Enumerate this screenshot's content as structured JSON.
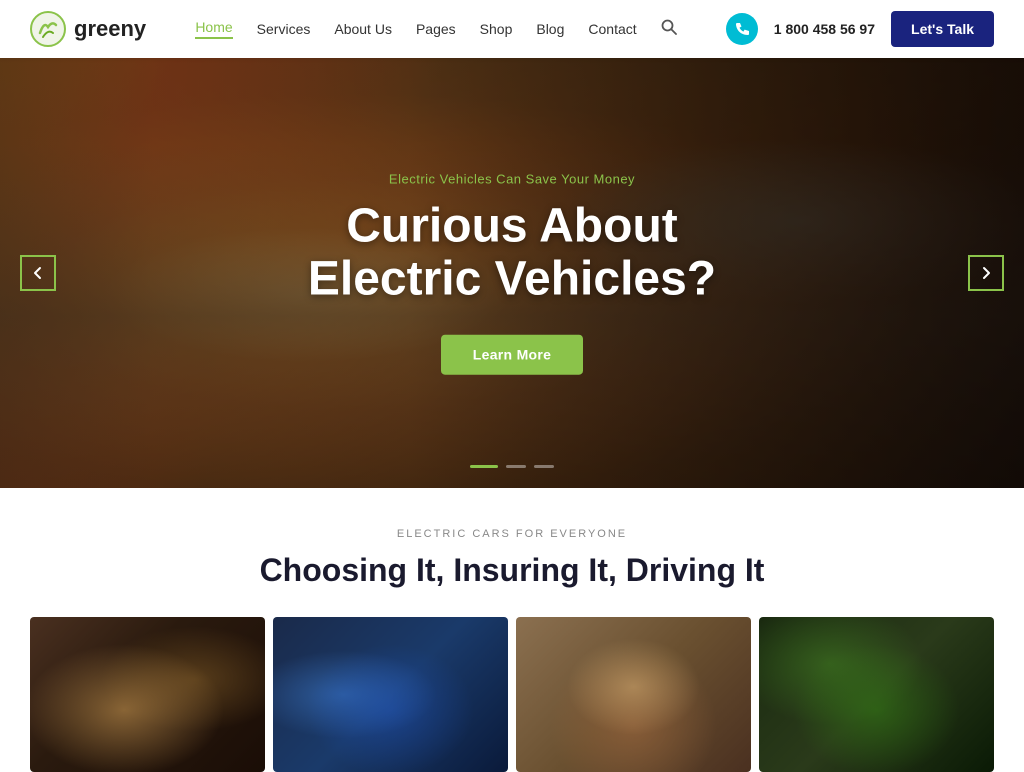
{
  "logo": {
    "text": "greeny",
    "alt": "Greeny logo"
  },
  "nav": {
    "items": [
      {
        "label": "Home",
        "active": true
      },
      {
        "label": "Services",
        "active": false
      },
      {
        "label": "About Us",
        "active": false
      },
      {
        "label": "Pages",
        "active": false
      },
      {
        "label": "Shop",
        "active": false
      },
      {
        "label": "Blog",
        "active": false
      },
      {
        "label": "Contact",
        "active": false
      }
    ]
  },
  "header": {
    "phone": "1 800 458 56 97",
    "cta_label": "Let's Talk"
  },
  "hero": {
    "eyebrow": "Electric Vehicles Can Save Your Money",
    "title_line1": "Curious About",
    "title_line2": "Electric Vehicles?",
    "cta_label": "Learn More",
    "arrow_left": "←",
    "arrow_right": "→",
    "dots": [
      {
        "active": true
      },
      {
        "active": false
      },
      {
        "active": false
      }
    ]
  },
  "section2": {
    "eyebrow": "ELECTRIC CARS FOR EVERYONE",
    "title": "Choosing It, Insuring It, Driving It",
    "images": [
      {
        "alt": "Car interior detail"
      },
      {
        "alt": "EV charging connector"
      },
      {
        "alt": "Happy people in car"
      },
      {
        "alt": "Green plant"
      }
    ]
  }
}
